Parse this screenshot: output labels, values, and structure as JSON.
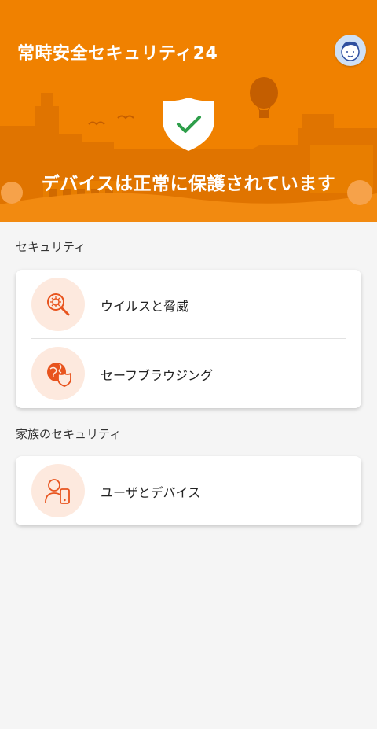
{
  "header": {
    "app_title": "常時安全セキュリティ24",
    "status": "デバイスは正常に保護されています",
    "bg_color": "#f08100"
  },
  "sections": [
    {
      "title": "セキュリティ",
      "items": [
        {
          "label": "ウイルスと脅威",
          "icon": "virus-scan-icon"
        },
        {
          "label": "セーフブラウジング",
          "icon": "globe-shield-icon"
        }
      ]
    },
    {
      "title": "家族のセキュリティ",
      "items": [
        {
          "label": "ユーザとデバイス",
          "icon": "user-device-icon"
        }
      ]
    }
  ],
  "colors": {
    "accent": "#f08100",
    "icon_bg": "#fde9de",
    "icon_stroke": "#e8541e",
    "check": "#2e9e4a"
  }
}
